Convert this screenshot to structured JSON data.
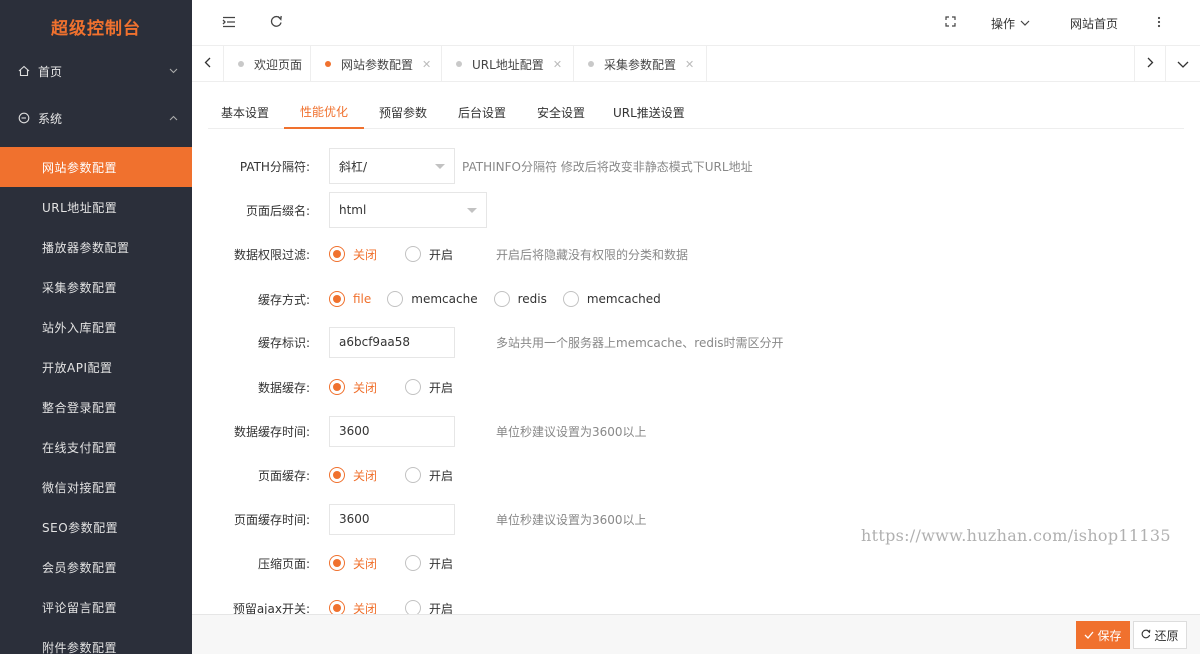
{
  "brand": "超级控制台",
  "colors": {
    "accent": "#f0712e",
    "sidebar_bg": "#2b2f3a"
  },
  "sidebar": {
    "home": {
      "label": "首页",
      "icon": "home-icon"
    },
    "system": {
      "label": "系统",
      "icon": "system-icon"
    },
    "items": [
      {
        "label": "网站参数配置",
        "active": true
      },
      {
        "label": "URL地址配置"
      },
      {
        "label": "播放器参数配置"
      },
      {
        "label": "采集参数配置"
      },
      {
        "label": "站外入库配置"
      },
      {
        "label": "开放API配置"
      },
      {
        "label": "整合登录配置"
      },
      {
        "label": "在线支付配置"
      },
      {
        "label": "微信对接配置"
      },
      {
        "label": "SEO参数配置"
      },
      {
        "label": "会员参数配置"
      },
      {
        "label": "评论留言配置"
      },
      {
        "label": "附件参数配置"
      }
    ]
  },
  "header": {
    "menu_icon": "menu-fold-icon",
    "refresh_icon": "refresh-icon",
    "fullscreen_icon": "fullscreen-icon",
    "operate_label": "操作",
    "site_home_label": "网站首页",
    "more_icon": "more-vertical-icon"
  },
  "tabs": [
    {
      "label": "欢迎页面",
      "closable": false
    },
    {
      "label": "网站参数配置",
      "active": true,
      "closable": true
    },
    {
      "label": "URL地址配置",
      "closable": true
    },
    {
      "label": "采集参数配置",
      "closable": true
    }
  ],
  "subtabs": [
    "基本设置",
    "性能优化",
    "预留参数",
    "后台设置",
    "安全设置",
    "URL推送设置"
  ],
  "form": {
    "path_sep": {
      "label": "PATH分隔符:",
      "value": "斜杠/",
      "hint": "PATHINFO分隔符 修改后将改变非静态模式下URL地址"
    },
    "suffix": {
      "label": "页面后缀名:",
      "value": "html"
    },
    "data_filter": {
      "label": "数据权限过滤:",
      "options": [
        "关闭",
        "开启"
      ],
      "selected": "关闭",
      "hint": "开启后将隐藏没有权限的分类和数据"
    },
    "cache_type": {
      "label": "缓存方式:",
      "options": [
        "file",
        "memcache",
        "redis",
        "memcached"
      ],
      "selected": "file"
    },
    "cache_flag": {
      "label": "缓存标识:",
      "value": "a6bcf9aa58",
      "hint": "多站共用一个服务器上memcache、redis时需区分开"
    },
    "data_cache": {
      "label": "数据缓存:",
      "options": [
        "关闭",
        "开启"
      ],
      "selected": "关闭"
    },
    "data_cache_time": {
      "label": "数据缓存时间:",
      "value": "3600",
      "hint": "单位秒建议设置为3600以上"
    },
    "page_cache": {
      "label": "页面缓存:",
      "options": [
        "关闭",
        "开启"
      ],
      "selected": "关闭"
    },
    "page_cache_time": {
      "label": "页面缓存时间:",
      "value": "3600",
      "hint": "单位秒建议设置为3600以上"
    },
    "compress": {
      "label": "压缩页面:",
      "options": [
        "关闭",
        "开启"
      ],
      "selected": "关闭"
    },
    "ajax": {
      "label": "预留ajax开关:",
      "options": [
        "关闭",
        "开启"
      ],
      "selected": "关闭"
    }
  },
  "watermark": "https://www.huzhan.com/ishop11135",
  "footer": {
    "save_label": "保存",
    "reset_label": "还原"
  }
}
